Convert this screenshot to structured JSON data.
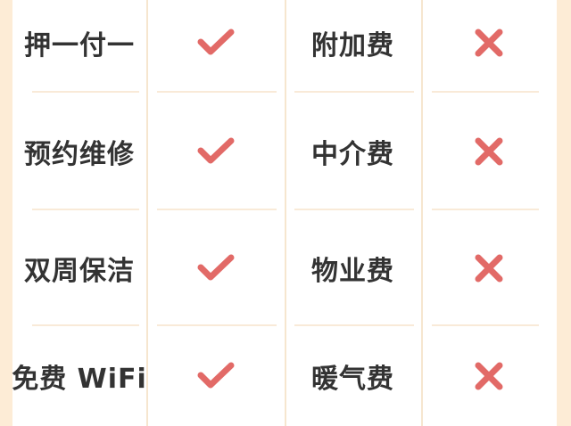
{
  "colors": {
    "background": "#fdecd6",
    "panel": "#ffffff",
    "text": "#333333",
    "icon_red": "#e26a67",
    "divider": "#f6e6cf"
  },
  "rows": [
    {
      "included_label": "押一付一",
      "included_icon": "check-icon",
      "excluded_label": "附加费",
      "excluded_icon": "cross-icon"
    },
    {
      "included_label": "预约维修",
      "included_icon": "check-icon",
      "excluded_label": "中介费",
      "excluded_icon": "cross-icon"
    },
    {
      "included_label": "双周保洁",
      "included_icon": "check-icon",
      "excluded_label": "物业费",
      "excluded_icon": "cross-icon"
    },
    {
      "included_label": "免费 WiFi",
      "included_icon": "check-icon",
      "excluded_label": "暖气费",
      "excluded_icon": "cross-icon"
    }
  ]
}
